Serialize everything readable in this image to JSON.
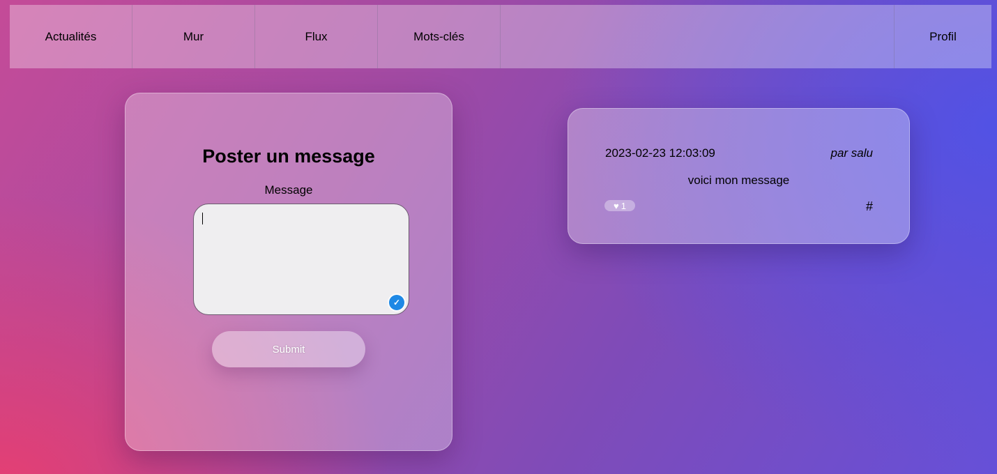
{
  "nav": {
    "items": [
      "Actualités",
      "Mur",
      "Flux",
      "Mots-clés"
    ],
    "profile": "Profil"
  },
  "form": {
    "title": "Poster un message",
    "label": "Message",
    "input_value": "",
    "submit_label": "Submit",
    "check_icon": "✓"
  },
  "post": {
    "date": "2023-02-23 12:03:09",
    "author": "par salu",
    "text": "voici mon message",
    "like_icon": "♥",
    "likes": "1",
    "hash": "#"
  },
  "colors": {
    "accent_blue": "#1e88e5"
  }
}
